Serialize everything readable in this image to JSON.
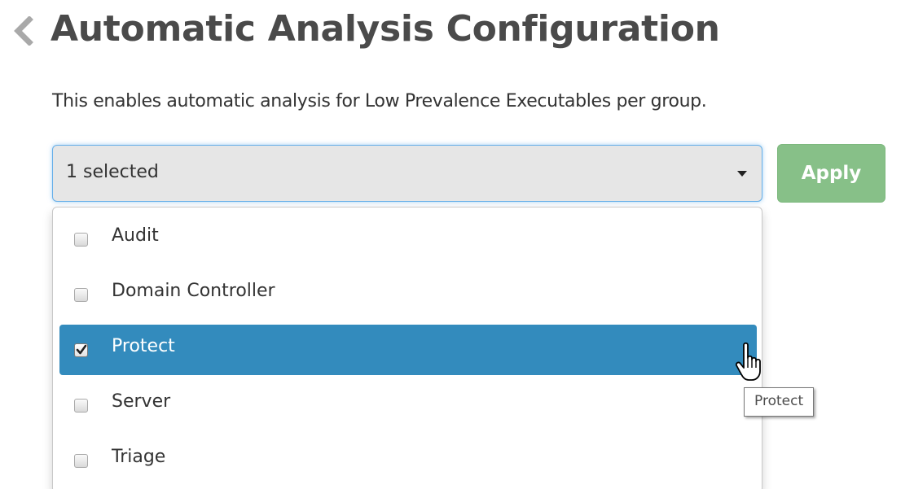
{
  "header": {
    "title": "Automatic Analysis Configuration",
    "back_icon": "chevron-left-icon"
  },
  "description": "This enables automatic analysis for Low Prevalence Executables per group.",
  "group_select": {
    "value": "1 selected",
    "caret_icon": "caret-down-icon",
    "options": [
      {
        "label": "Audit",
        "checked": false
      },
      {
        "label": "Domain Controller",
        "checked": false
      },
      {
        "label": "Protect",
        "checked": true
      },
      {
        "label": "Server",
        "checked": false
      },
      {
        "label": "Triage",
        "checked": false
      }
    ]
  },
  "apply_button": {
    "label": "Apply"
  },
  "tooltip": {
    "text": "Protect"
  },
  "colors": {
    "title": "#4a4a4a",
    "select_background": "#e6e6e6",
    "focus_border": "#66afe9",
    "apply_button": "#87c088",
    "selected_option": "#338bbd"
  }
}
